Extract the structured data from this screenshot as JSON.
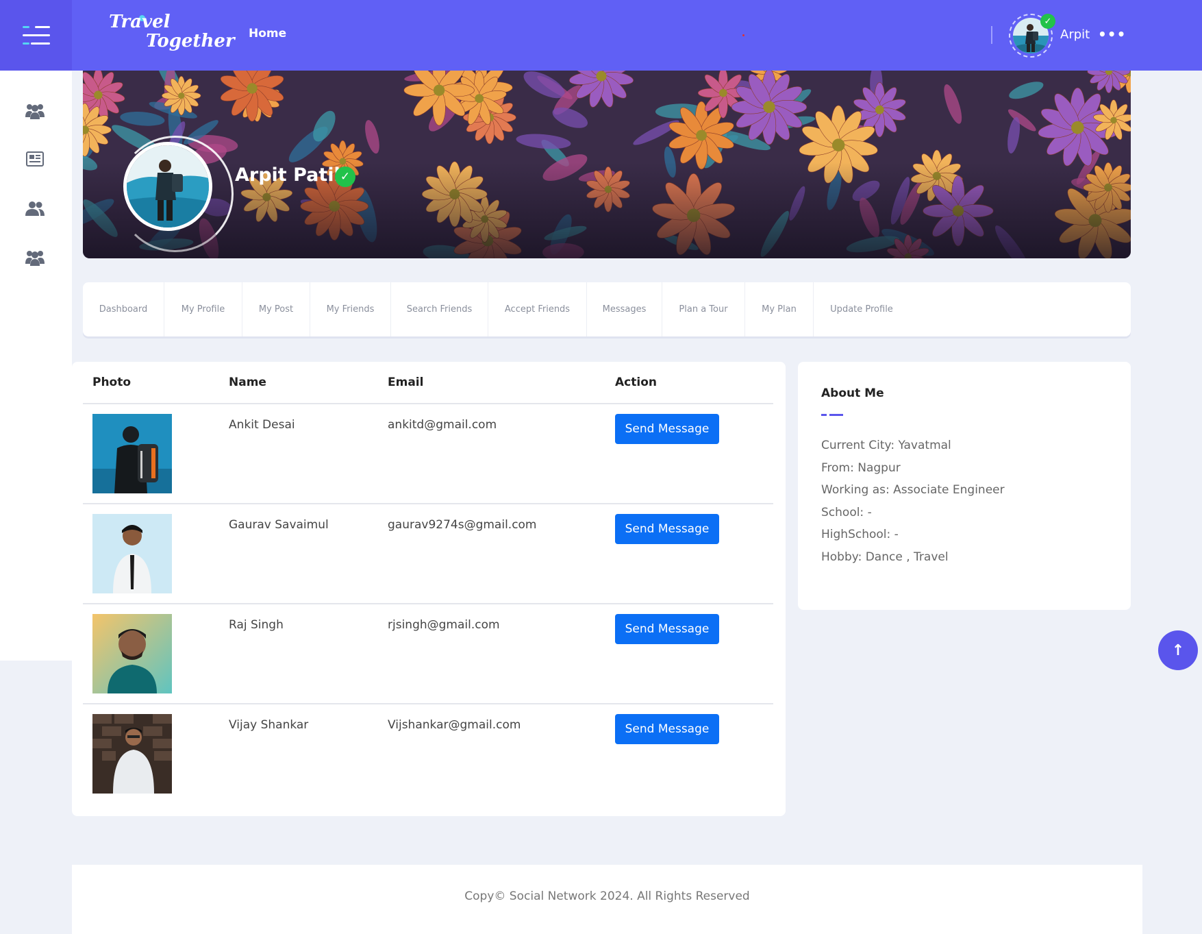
{
  "header": {
    "logo_line1": "Travel",
    "logo_line2": "Together",
    "home_link": "Home",
    "username": "Arpit",
    "more_label": "•••",
    "verified_mark": "✓",
    "accent_color": "#6060f5"
  },
  "sidebar": {
    "items": [
      {
        "icon": "users-group-icon"
      },
      {
        "icon": "newspaper-icon"
      },
      {
        "icon": "user-friends-icon"
      },
      {
        "icon": "users-group-icon"
      }
    ]
  },
  "profile": {
    "name": "Arpit Patil",
    "verified_mark": "✓"
  },
  "tabs": [
    {
      "label": "Dashboard"
    },
    {
      "label": "My Profile"
    },
    {
      "label": "My Post"
    },
    {
      "label": "My Friends"
    },
    {
      "label": "Search Friends"
    },
    {
      "label": "Accept Friends"
    },
    {
      "label": "Messages"
    },
    {
      "label": "Plan a Tour"
    },
    {
      "label": "My Plan"
    },
    {
      "label": "Update Profile"
    }
  ],
  "friends_table": {
    "headers": {
      "photo": "Photo",
      "name": "Name",
      "email": "Email",
      "action": "Action"
    },
    "rows": [
      {
        "name": "Ankit Desai",
        "email": "ankitd@gmail.com",
        "action": "Send Message"
      },
      {
        "name": "Gaurav Savaimul",
        "email": "gaurav9274s@gmail.com",
        "action": "Send Message"
      },
      {
        "name": "Raj Singh",
        "email": "rjsingh@gmail.com",
        "action": "Send Message"
      },
      {
        "name": "Vijay Shankar",
        "email": "Vijshankar@gmail.com",
        "action": "Send Message"
      }
    ]
  },
  "about": {
    "title": "About Me",
    "items": [
      "Current City: Yavatmal",
      "From: Nagpur",
      "Working as: Associate Engineer",
      "School: -",
      "HighSchool: -",
      "Hobby: Dance , Travel"
    ]
  },
  "scroll_top_icon": "↑",
  "footer": {
    "text": "Copy© Social Network 2024. All Rights Reserved"
  }
}
